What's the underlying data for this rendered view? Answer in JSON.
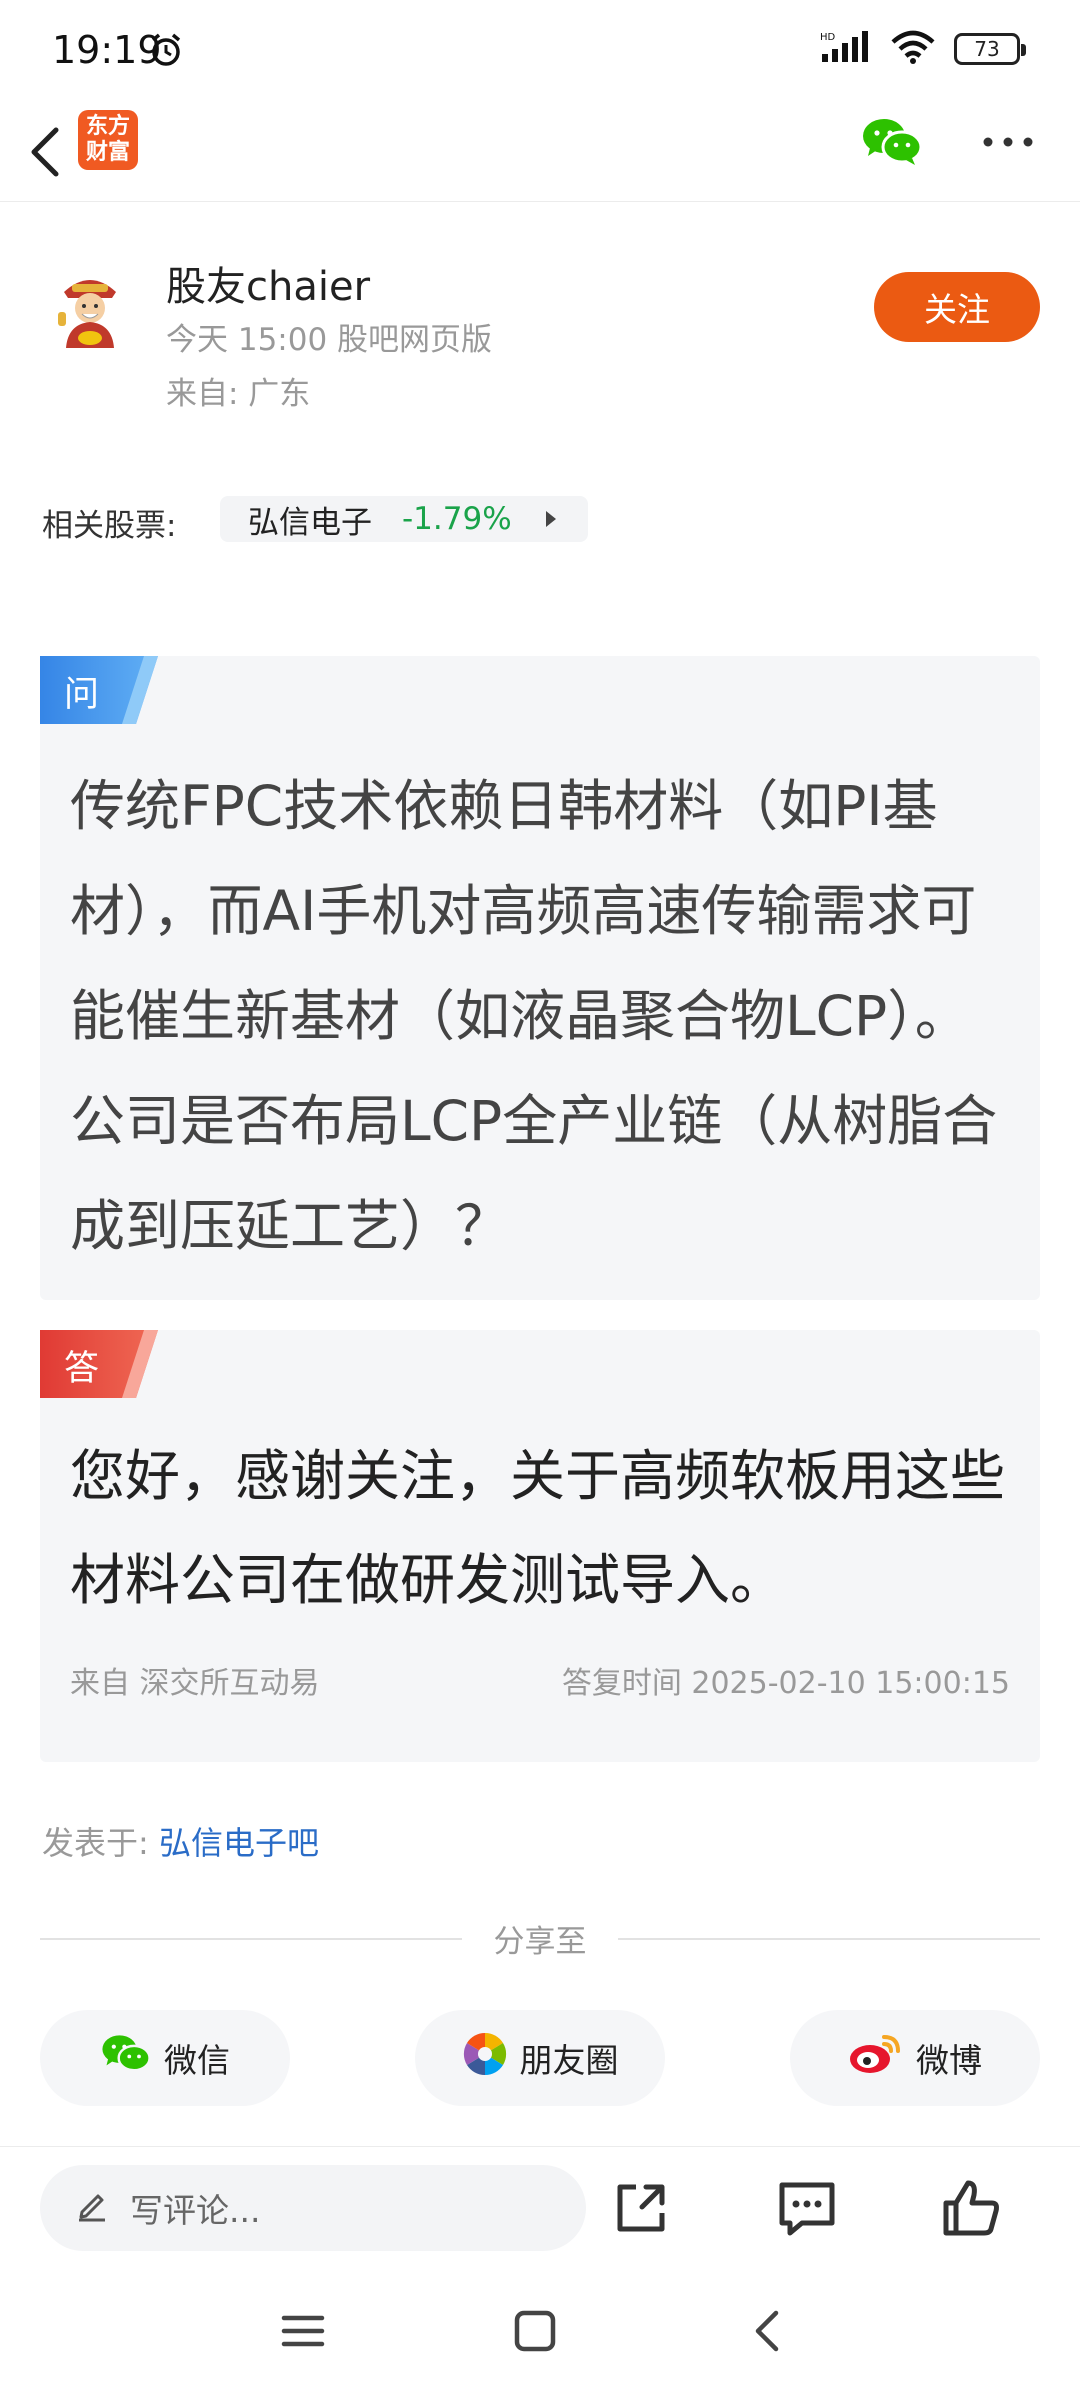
{
  "status_bar": {
    "time": "19:19",
    "battery": "73",
    "icons": [
      "alarm-icon",
      "hd-signal-icon",
      "wifi-icon",
      "battery-icon"
    ]
  },
  "nav": {
    "logo_line1": "东方",
    "logo_line2": "财富",
    "icons": [
      "back-arrow-icon",
      "wechat-icon",
      "more-icon"
    ]
  },
  "author": {
    "name": "股友chaier",
    "meta": "今天 15:00 股吧网页版",
    "from": "来自: 广东",
    "follow_label": "关注"
  },
  "related": {
    "label": "相关股票:",
    "stock_name": "弘信电子",
    "change": "-1.79%"
  },
  "question": {
    "tag": "问",
    "text": "传统FPC技术依赖日韩材料（如PI基材），而AI手机对高频高速传输需求可能催生新基材（如液晶聚合物LCP）。公司是否布局LCP全产业链（从树脂合成到压延工艺）？"
  },
  "answer": {
    "tag": "答",
    "text": "您好，感谢关注，关于高频软板用这些材料公司在做研发测试导入。",
    "source": "来自 深交所互动易",
    "reply_time": "答复时间 2025-02-10 15:00:15"
  },
  "posted": {
    "label": "发表于: ",
    "bar_name": "弘信电子吧"
  },
  "share": {
    "title": "分享至",
    "wechat": "微信",
    "moments": "朋友圈",
    "weibo": "微博"
  },
  "bottom": {
    "comment_placeholder": "写评论..."
  },
  "colors": {
    "accent_orange": "#eb5a12",
    "question_blue": "#3d8ee8",
    "answer_red": "#e5483d",
    "stock_green": "#1aa34a",
    "link_blue": "#2a6cc7"
  }
}
